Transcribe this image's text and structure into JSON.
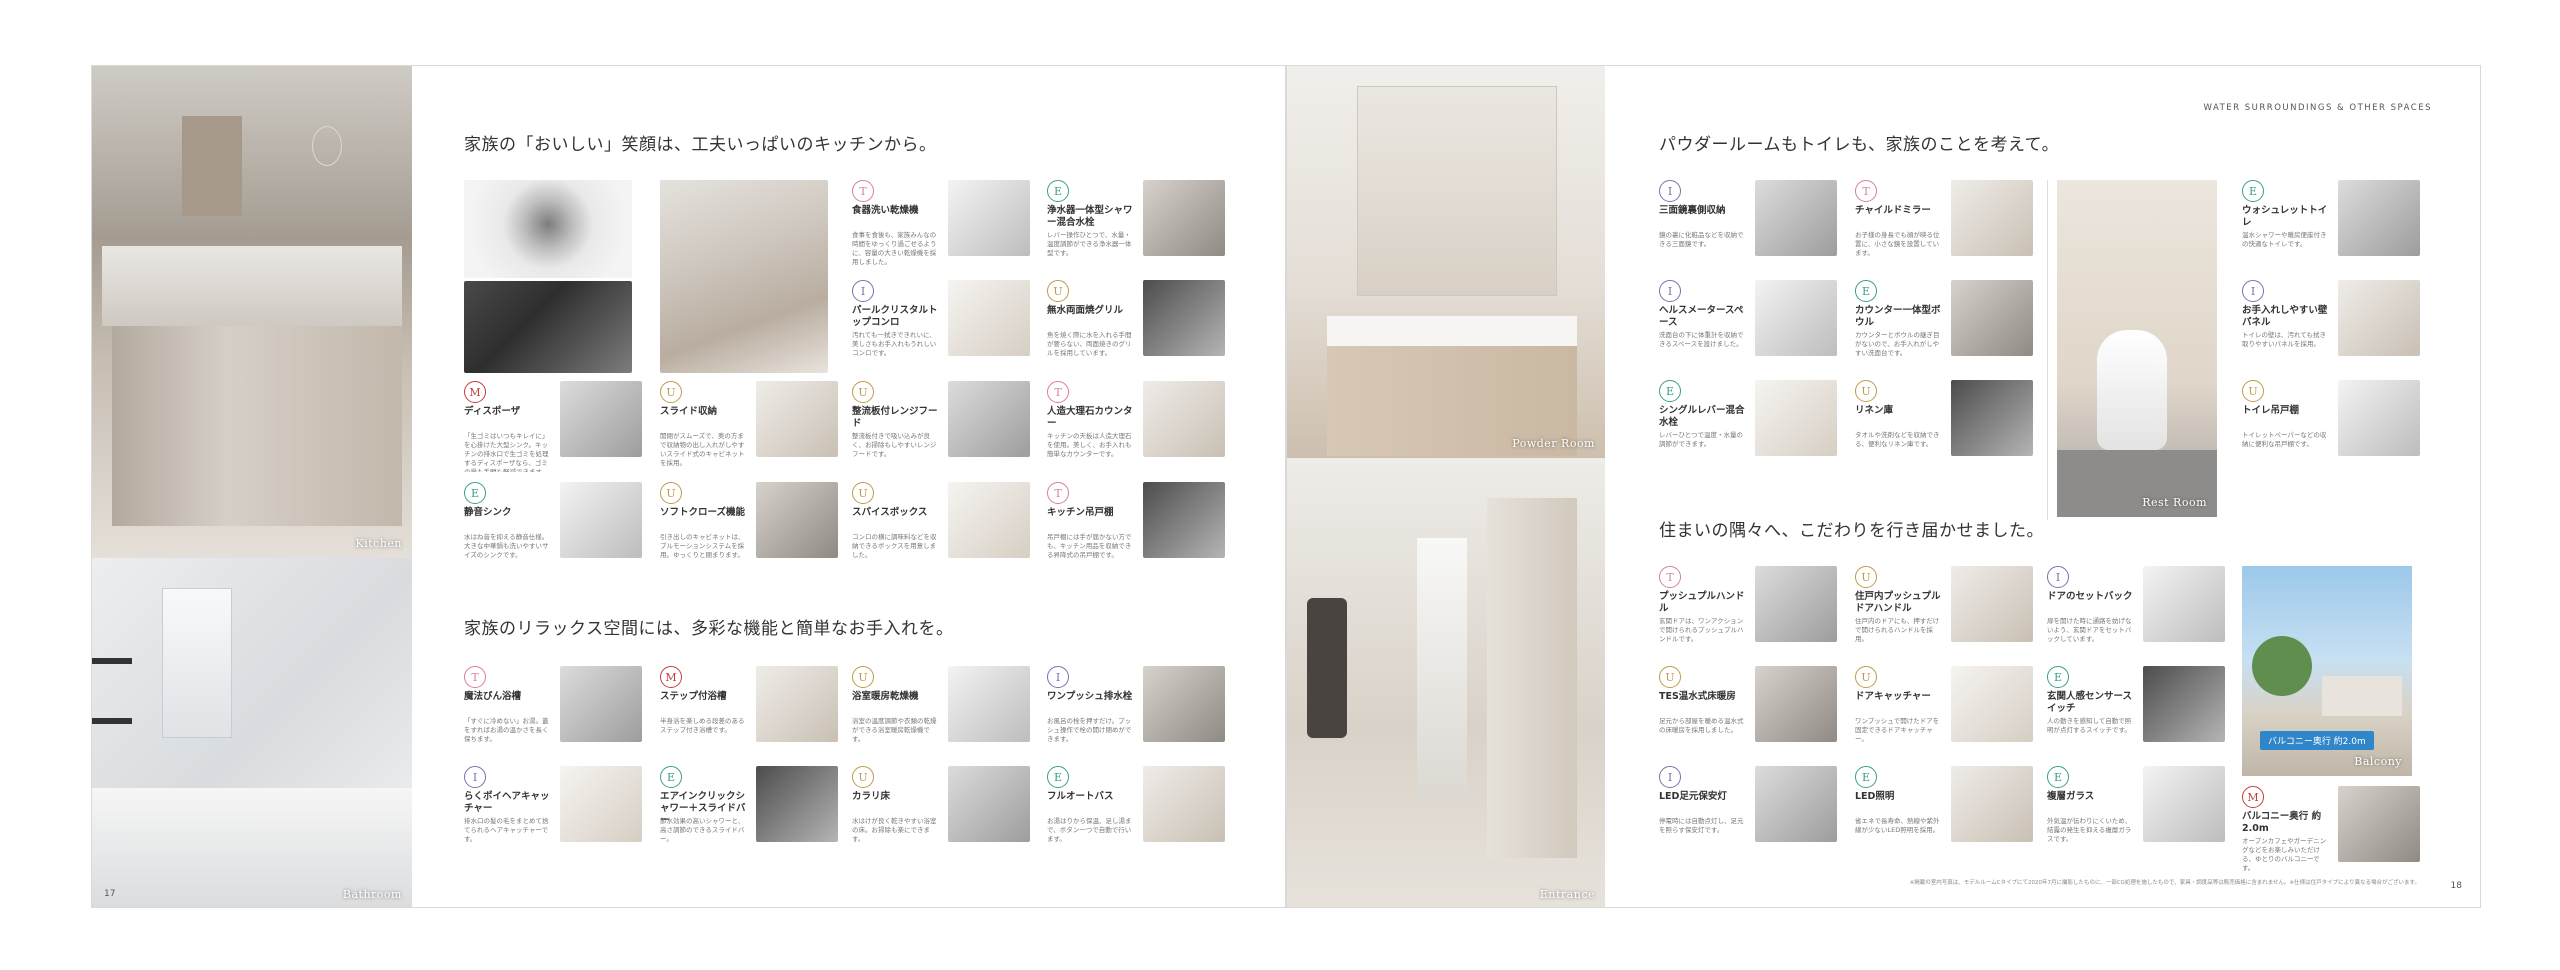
{
  "left_page": {
    "page_number": "17",
    "photos": {
      "kitchen": "Kitchen",
      "bathroom": "Bathroom"
    },
    "section1_heading": "家族の「おいしい」笑顔は、工夫いっぱいのキッチンから。",
    "section2_heading": "家族のリラックス空間には、多彩な機能と簡単なお手入れを。",
    "kitchen_items": [
      {
        "badge": "M",
        "title": "ディスポーザ",
        "desc": "「生ゴミはいつもキレイに」を心掛けた大型シンク。キッチンの排水口で生ゴミを処理するディスポーザなら、ゴミの量も手間も軽減できます。"
      },
      {
        "badge": "U",
        "title": "スライド収納",
        "desc": "開閉がスムーズで、奥の方まで収納物の出し入れがしやすいスライド式のキャビネットを採用。"
      },
      {
        "badge": "T",
        "title": "食器洗い乾燥機",
        "desc": "食事を食後も、家族みんなの時間をゆっくり過ごせるように、容量の大きい乾燥機を採用しました。"
      },
      {
        "badge": "E",
        "title": "浄水器一体型シャワー混合水栓",
        "desc": "レバー操作ひとつで、水量・温度調節ができる浄水器一体型です。"
      },
      {
        "badge": "I",
        "title": "パールクリスタルトップコンロ",
        "desc": "汚れても一拭きできれいに、美しさもお手入れもうれしいコンロです。"
      },
      {
        "badge": "U",
        "title": "無水両面焼グリル",
        "desc": "魚を焼く際に水を入れる手間が要らない、両面焼きのグリルを採用しています。"
      },
      {
        "badge": "U",
        "title": "整流板付レンジフード",
        "desc": "整流板付きで吸い込みが良く、お掃除もしやすいレンジフードです。"
      },
      {
        "badge": "T",
        "title": "人造大理石カウンター",
        "desc": "キッチンの天板は人造大理石を使用。美しく、お手入れも簡単なカウンターです。"
      },
      {
        "badge": "E",
        "title": "静音シンク",
        "desc": "水はね音を抑える静音仕様。大きな中華鍋も洗いやすいサイズのシンクです。"
      },
      {
        "badge": "U",
        "title": "ソフトクローズ機能",
        "desc": "引き出しのキャビネットは、ブルモーションシステムを採用。ゆっくりと閉まります。"
      },
      {
        "badge": "U",
        "title": "スパイスボックス",
        "desc": "コンロの横に調味料などを収納できるボックスを用意しました。"
      },
      {
        "badge": "T",
        "title": "キッチン吊戸棚",
        "desc": "吊戸棚には手が届かない方でも、キッチン用品を収納できる昇降式の吊戸棚です。"
      }
    ],
    "bath_items": [
      {
        "badge": "T",
        "title": "魔法びん浴槽",
        "desc": "「すぐに冷めない」お湯。蓋をすればお湯の温かさを長く保ちます。"
      },
      {
        "badge": "M",
        "title": "ステップ付浴槽",
        "desc": "半身浴を楽しめる段差のあるステップ付き浴槽です。"
      },
      {
        "badge": "U",
        "title": "浴室暖房乾燥機",
        "desc": "浴室の温度調節や衣類の乾燥ができる浴室暖房乾燥機です。"
      },
      {
        "badge": "I",
        "title": "ワンプッシュ排水栓",
        "desc": "お風呂の栓を押すだけ。プッシュ操作で栓の開け閉めができます。"
      },
      {
        "badge": "I",
        "title": "らくポイヘアキャッチャー",
        "desc": "排水口の髪の毛をまとめて捨てられるヘアキャッチャーです。"
      },
      {
        "badge": "E",
        "title": "エアインクリックシャワー＋スライドバー",
        "desc": "節水効果の高いシャワーと、高さ調節のできるスライドバー。"
      },
      {
        "badge": "U",
        "title": "カラリ床",
        "desc": "水はけが良く乾きやすい浴室の床。お掃除も楽にできます。"
      },
      {
        "badge": "E",
        "title": "フルオートバス",
        "desc": "お湯はりから保温、足し湯まで、ボタン一つで自動で行います。"
      }
    ]
  },
  "right_page": {
    "page_number": "18",
    "top_caption": "WATER SURROUNDINGS & OTHER SPACES",
    "photos": {
      "powder": "Powder Room",
      "entrance": "Entrance",
      "rest": "Rest Room",
      "balcony": "Balcony"
    },
    "balcony_tag": "バルコニー奥行 約2.0m",
    "section1_heading": "パウダールームもトイレも、家族のことを考えて。",
    "section2_heading": "住まいの隅々へ、こだわりを行き届かせました。",
    "powder_items": [
      {
        "badge": "I",
        "title": "三面鏡裏側収納",
        "desc": "鏡の裏に化粧品などを収納できる三面鏡です。"
      },
      {
        "badge": "T",
        "title": "チャイルドミラー",
        "desc": "お子様の身長でも顔が映る位置に、小さな鏡を設置しています。"
      },
      {
        "badge": "I",
        "title": "ヘルスメータースペース",
        "desc": "洗面台の下に体重計を収納できるスペースを設けました。"
      },
      {
        "badge": "E",
        "title": "カウンター一体型ボウル",
        "desc": "カウンターとボウルの継ぎ目がないので、お手入れがしやすい洗面台です。"
      },
      {
        "badge": "E",
        "title": "シングルレバー混合水栓",
        "desc": "レバーひとつで温度・水量の調節ができます。"
      },
      {
        "badge": "U",
        "title": "リネン庫",
        "desc": "タオルや洗剤などを収納できる、便利なリネン庫です。"
      }
    ],
    "toilet_items": [
      {
        "badge": "E",
        "title": "ウォシュレットトイレ",
        "desc": "温水シャワーや暖房便座付きの快適なトイレです。"
      },
      {
        "badge": "I",
        "title": "お手入れしやすい壁パネル",
        "desc": "トイレの壁は、汚れても拭き取りやすいパネルを採用。"
      },
      {
        "badge": "U",
        "title": "トイレ吊戸棚",
        "desc": "トイレットペーパーなどの収納に便利な吊戸棚です。"
      }
    ],
    "misc_items": [
      {
        "badge": "T",
        "title": "プッシュプルハンドル",
        "desc": "玄関ドアは、ワンアクションで開けられるプッシュプルハンドルです。"
      },
      {
        "badge": "U",
        "title": "住戸内プッシュプルドアハンドル",
        "desc": "住戸内のドアにも、押すだけで開けられるハンドルを採用。"
      },
      {
        "badge": "I",
        "title": "ドアのセットバック",
        "desc": "扉を開けた時に通路を妨げないよう、玄関ドアをセットバックしています。"
      },
      {
        "badge": "U",
        "title": "TES温水式床暖房",
        "desc": "足元から部屋を暖める温水式の床暖房を採用しました。"
      },
      {
        "badge": "U",
        "title": "ドアキャッチャー",
        "desc": "ワンプッシュで開けたドアを固定できるドアキャッチャー。"
      },
      {
        "badge": "E",
        "title": "玄関人感センサースイッチ",
        "desc": "人の動きを感知して自動で照明が点灯するスイッチです。"
      },
      {
        "badge": "I",
        "title": "LED足元保安灯",
        "desc": "停電時には自動点灯し、足元を照らす保安灯です。"
      },
      {
        "badge": "E",
        "title": "LED照明",
        "desc": "省エネで長寿命、熱線や紫外線が少ないLED照明を採用。"
      },
      {
        "badge": "E",
        "title": "複層ガラス",
        "desc": "外気温が伝わりにくいため、結露の発生を抑える複層ガラスです。"
      },
      {
        "badge": "M",
        "title": "バルコニー奥行 約2.0m",
        "desc": "オープンカフェやガーデニングなどをお楽しみいただける、ゆとりのバルコニーです。"
      }
    ],
    "footnote": "※掲載の室内写真は、モデルルームCタイプにて2020年7月に撮影したものに、一部CG処理を施したもので、家具・調度品等は販売価格に含まれません。※仕様は住戸タイプにより異なる場合がございます。"
  },
  "colors": {
    "T": "#d77e99",
    "E": "#3a9e88",
    "I": "#7a6fb0",
    "U": "#c09a46",
    "M": "#c43d3d"
  }
}
